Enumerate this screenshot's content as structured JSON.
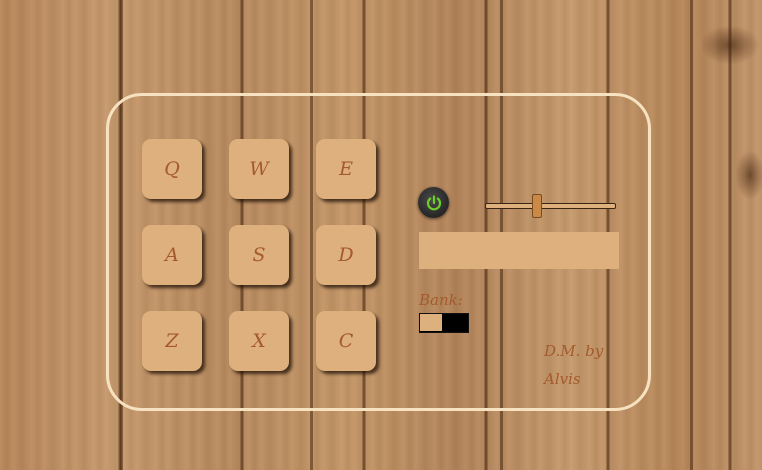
{
  "pads": [
    {
      "key": "Q"
    },
    {
      "key": "W"
    },
    {
      "key": "E"
    },
    {
      "key": "A"
    },
    {
      "key": "S"
    },
    {
      "key": "D"
    },
    {
      "key": "Z"
    },
    {
      "key": "X"
    },
    {
      "key": "C"
    }
  ],
  "power": {
    "icon": "power-icon",
    "state": "on",
    "color": "#6fcf2a"
  },
  "volume": {
    "value": 0.4
  },
  "display": {
    "text": ""
  },
  "bank": {
    "label": "Bank:",
    "state": "off"
  },
  "credit": {
    "line1": "D.M. by",
    "line2": "Alvis"
  },
  "colors": {
    "pad": "#deb07d",
    "text": "#a45a2c",
    "border": "#f6e2c0"
  }
}
